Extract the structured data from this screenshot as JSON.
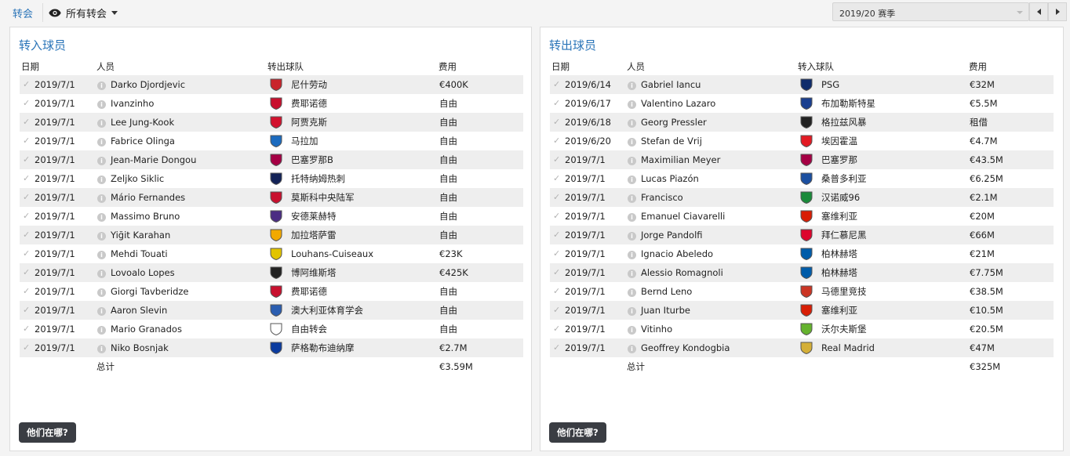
{
  "top": {
    "tab_label": "转会",
    "filter_label": "所有转会",
    "season_label": "2019/20 赛季"
  },
  "incoming": {
    "title": "转入球员",
    "headers": {
      "date": "日期",
      "person": "人员",
      "club": "转出球队",
      "fee": "费用"
    },
    "rows": [
      {
        "date": "2019/7/1",
        "person": "Darko Djordjevic",
        "club": "尼什劳动",
        "fee": "€400K",
        "badge": "#c9242b"
      },
      {
        "date": "2019/7/1",
        "person": "Ivanzinho",
        "club": "费耶诺德",
        "fee": "自由",
        "badge": "#c8102e"
      },
      {
        "date": "2019/7/1",
        "person": "Lee Jung-Kook",
        "club": "阿贾克斯",
        "fee": "自由",
        "badge": "#d2122e"
      },
      {
        "date": "2019/7/1",
        "person": "Fabrice Olinga",
        "club": "马拉加",
        "fee": "自由",
        "badge": "#1c6bbf"
      },
      {
        "date": "2019/7/1",
        "person": "Jean-Marie Dongou",
        "club": "巴塞罗那B",
        "fee": "自由",
        "badge": "#a50044"
      },
      {
        "date": "2019/7/1",
        "person": "Zeljko Siklic",
        "club": "托特纳姆热刺",
        "fee": "自由",
        "badge": "#132257"
      },
      {
        "date": "2019/7/1",
        "person": "Mário Fernandes",
        "club": "莫斯科中央陆军",
        "fee": "自由",
        "badge": "#c8102e"
      },
      {
        "date": "2019/7/1",
        "person": "Massimo Bruno",
        "club": "安德莱赫特",
        "fee": "自由",
        "badge": "#4b2d83"
      },
      {
        "date": "2019/7/1",
        "person": "Yiğit Karahan",
        "club": "加拉塔萨雷",
        "fee": "自由",
        "badge": "#f2a900"
      },
      {
        "date": "2019/7/1",
        "person": "Mehdi Touati",
        "club": "Louhans-Cuiseaux",
        "fee": "€23K",
        "badge": "#e2c400"
      },
      {
        "date": "2019/7/1",
        "person": "Lovoalo Lopes",
        "club": "博阿维斯塔",
        "fee": "€425K",
        "badge": "#222222"
      },
      {
        "date": "2019/7/1",
        "person": "Giorgi Tavberidze",
        "club": "费耶诺德",
        "fee": "自由",
        "badge": "#c8102e"
      },
      {
        "date": "2019/7/1",
        "person": "Aaron Slevin",
        "club": "澳大利亚体育学会",
        "fee": "自由",
        "badge": "#2a5db0"
      },
      {
        "date": "2019/7/1",
        "person": "Mario Granados",
        "club": "自由转会",
        "fee": "自由",
        "badge": "#ffffff"
      },
      {
        "date": "2019/7/1",
        "person": "Niko Bosnjak",
        "club": "萨格勒布迪纳摩",
        "fee": "€2.7M",
        "badge": "#0b3b9f"
      }
    ],
    "total_label": "总计",
    "total_value": "€3.59M",
    "where_button": "他们在哪?"
  },
  "outgoing": {
    "title": "转出球员",
    "headers": {
      "date": "日期",
      "person": "人员",
      "club": "转入球队",
      "fee": "费用"
    },
    "rows": [
      {
        "date": "2019/6/14",
        "person": "Gabriel Iancu",
        "club": "PSG",
        "fee": "€32M",
        "badge": "#0f2c6b"
      },
      {
        "date": "2019/6/17",
        "person": "Valentino Lazaro",
        "club": "布加勒斯特星",
        "fee": "€5.5M",
        "badge": "#1a3f8f"
      },
      {
        "date": "2019/6/18",
        "person": "Georg Pressler",
        "club": "格拉兹风暴",
        "fee": "租借",
        "badge": "#222222"
      },
      {
        "date": "2019/6/20",
        "person": "Stefan de Vrij",
        "club": "埃因霍温",
        "fee": "€4.7M",
        "badge": "#e21a23"
      },
      {
        "date": "2019/7/1",
        "person": "Maximilian Meyer",
        "club": "巴塞罗那",
        "fee": "€43.5M",
        "badge": "#a50044"
      },
      {
        "date": "2019/7/1",
        "person": "Lucas Piazón",
        "club": "桑普多利亚",
        "fee": "€6.25M",
        "badge": "#1b4fa0"
      },
      {
        "date": "2019/7/1",
        "person": "Francisco",
        "club": "汉诺威96",
        "fee": "€2.1M",
        "badge": "#1a8a3a"
      },
      {
        "date": "2019/7/1",
        "person": "Emanuel Ciavarelli",
        "club": "塞维利亚",
        "fee": "€20M",
        "badge": "#d81e05"
      },
      {
        "date": "2019/7/1",
        "person": "Jorge Pandolfi",
        "club": "拜仁慕尼黑",
        "fee": "€66M",
        "badge": "#dc052d"
      },
      {
        "date": "2019/7/1",
        "person": "Ignacio Abeledo",
        "club": "柏林赫塔",
        "fee": "€21M",
        "badge": "#005ca9"
      },
      {
        "date": "2019/7/1",
        "person": "Alessio Romagnoli",
        "club": "柏林赫塔",
        "fee": "€7.75M",
        "badge": "#005ca9"
      },
      {
        "date": "2019/7/1",
        "person": "Bernd Leno",
        "club": "马德里竞技",
        "fee": "€38.5M",
        "badge": "#cb3524"
      },
      {
        "date": "2019/7/1",
        "person": "Juan Iturbe",
        "club": "塞维利亚",
        "fee": "€10.5M",
        "badge": "#d81e05"
      },
      {
        "date": "2019/7/1",
        "person": "Vitinho",
        "club": "沃尔夫斯堡",
        "fee": "€20.5M",
        "badge": "#65b32e"
      },
      {
        "date": "2019/7/1",
        "person": "Geoffrey Kondogbia",
        "club": "Real Madrid",
        "fee": "€47M",
        "badge": "#d4af37"
      }
    ],
    "total_label": "总计",
    "total_value": "€325M",
    "where_button": "他们在哪?"
  }
}
